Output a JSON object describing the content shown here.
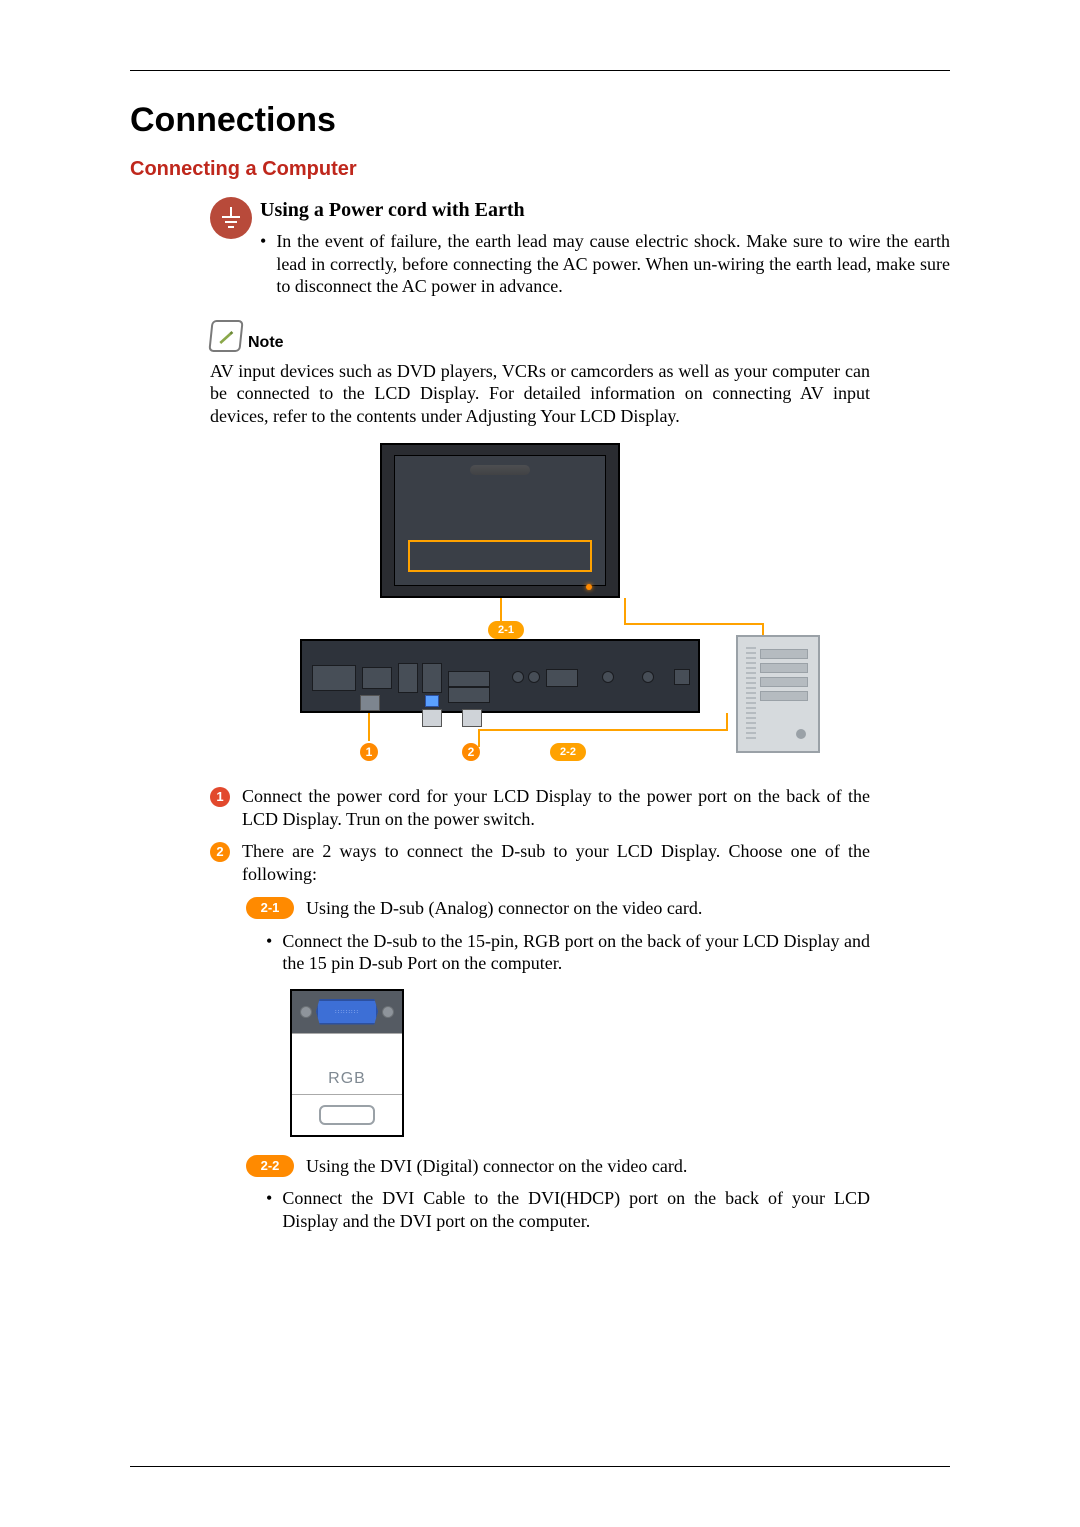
{
  "title": "Connections",
  "section": "Connecting a Computer",
  "earth": {
    "heading": "Using a Power cord with Earth",
    "text": "In the event of failure, the earth lead may cause electric shock. Make sure to wire the earth lead in correctly, before connecting the AC power. When un-wiring the earth lead, make sure to disconnect the AC power in advance."
  },
  "note": {
    "label": "Note",
    "text": "AV input devices such as DVD players, VCRs or camcorders as well as your computer can be connected to the LCD Display. For detailed information on connecting AV input devices, refer to the contents under Adjusting Your LCD Display."
  },
  "diagram_labels": {
    "pill_2_1": "2-1",
    "pill_2_2": "2-2",
    "callout_1": "1",
    "callout_2": "2"
  },
  "steps": {
    "s1": "Connect the power cord for your LCD Display to the power port on the back of the LCD Display. Trun on the power switch.",
    "s2": "There are 2 ways to connect the D-sub to your LCD Display. Choose one of the following:",
    "s2_1_pill": "2-1",
    "s2_1_text": "Using the D-sub (Analog) connector on the video card.",
    "s2_1_bullet": "Connect the D-sub to the 15-pin, RGB port on the back of your LCD Display and the 15 pin D-sub Port on the computer.",
    "rgb_label": "RGB",
    "s2_2_pill": "2-2",
    "s2_2_text": "Using the DVI (Digital) connector on the video card.",
    "s2_2_bullet": "Connect the DVI Cable to the DVI(HDCP) port on the back of your LCD Display and the DVI port on the computer."
  }
}
